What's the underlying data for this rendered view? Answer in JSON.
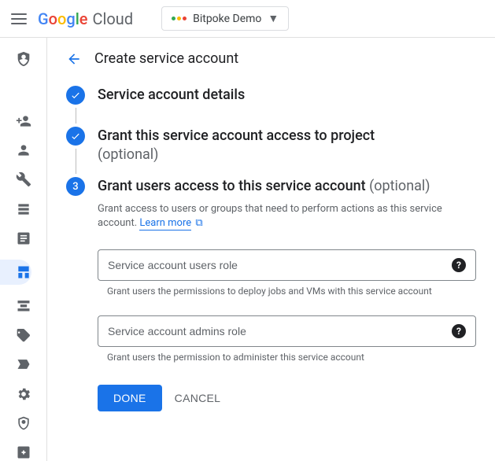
{
  "header": {
    "project_name": "Bitpoke Demo",
    "logo_cloud": "Cloud"
  },
  "page": {
    "title": "Create service account",
    "back_aria": "Back"
  },
  "steps": {
    "s1": {
      "title": "Service account details"
    },
    "s2": {
      "title": "Grant this service account access to project",
      "optional": "(optional)"
    },
    "s3": {
      "number": "3",
      "title": "Grant users access to this service account",
      "optional": "(optional)",
      "desc_prefix": "Grant access to users or groups that need to perform actions as this service account. ",
      "learn_more": "Learn more"
    }
  },
  "fields": {
    "users_role": {
      "placeholder": "Service account users role",
      "hint": "Grant users the permissions to deploy jobs and VMs with this service account"
    },
    "admins_role": {
      "placeholder": "Service account admins role",
      "hint": "Grant users the permission to administer this service account"
    }
  },
  "actions": {
    "done": "DONE",
    "cancel": "CANCEL"
  }
}
